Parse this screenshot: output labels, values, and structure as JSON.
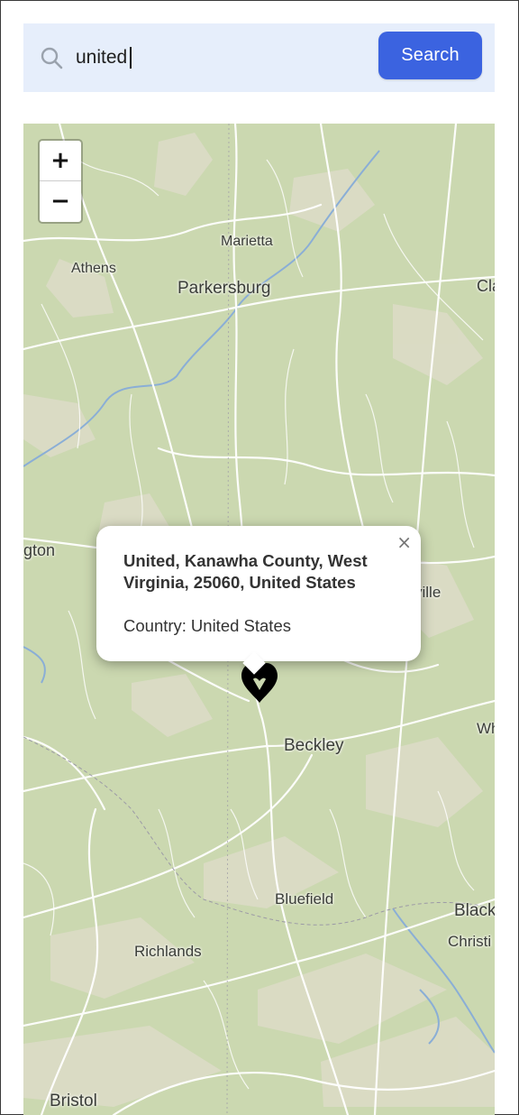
{
  "search": {
    "icon": "search-icon",
    "value": "united",
    "button_label": "Search"
  },
  "map": {
    "zoom_in_label": "+",
    "zoom_out_label": "−",
    "place_labels": {
      "marietta": "Marietta",
      "athens": "Athens",
      "parkersburg": "Parkersburg",
      "clarksburg_partial": "Cla",
      "huntington_partial": "gton",
      "summersville_partial": "ville",
      "beckley": "Beckley",
      "white_sulphur_partial": "Wh",
      "bluefield": "Bluefield",
      "blacksburg_partial": "Black",
      "christiansburg_partial": "Christi",
      "richlands": "Richlands",
      "bristol": "Bristol"
    },
    "colors": {
      "land": "#cbd8b0",
      "forest_light": "#dcdcc6",
      "road": "#ffffff",
      "water": "#8aaed6"
    }
  },
  "popup": {
    "title": "United, Kanawha County, West Virginia, 25060, United States",
    "country_label": "Country:",
    "country_value": "United States",
    "close_icon": "×"
  },
  "marker": {
    "icon": "location-marker-icon",
    "color": "#000000"
  },
  "colors": {
    "search_bar_bg": "#e6eefb",
    "search_button": "#3b63e0"
  }
}
